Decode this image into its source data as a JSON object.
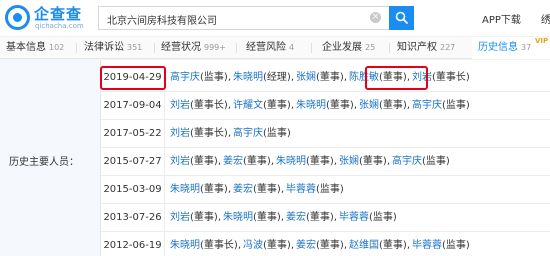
{
  "header": {
    "logo_title": "企查查",
    "logo_sub": "qichacha.com",
    "search_value": "北京六间房科技有限公司",
    "clear_glyph": "×",
    "app_download": "APP下载",
    "edge_text": "绣"
  },
  "tabs": [
    {
      "label": "基本信息",
      "count": "102"
    },
    {
      "label": "法律诉讼",
      "count": "351"
    },
    {
      "label": "经营状况",
      "count": "999+"
    },
    {
      "label": "经营风险",
      "count": "4"
    },
    {
      "label": "企业发展",
      "count": "25"
    },
    {
      "label": "知识产权",
      "count": "227"
    },
    {
      "label": "历史信息",
      "count": "37",
      "active": true
    }
  ],
  "vip_badge": "VIP",
  "section_label": "历史主要人员：",
  "rows": [
    {
      "date": "2019-04-29",
      "people": [
        {
          "name": "高宇庆",
          "role": "(监事)"
        },
        {
          "name": "朱晓明",
          "role": "(经理)"
        },
        {
          "name": "张娴",
          "role": "(董事)"
        },
        {
          "name": "陈胜敏",
          "role": "(董事)"
        },
        {
          "name": "刘岩",
          "role": "(董事长)"
        }
      ]
    },
    {
      "date": "2017-09-04",
      "people": [
        {
          "name": "刘岩",
          "role": "(董事长)"
        },
        {
          "name": "许耀文",
          "role": "(董事)"
        },
        {
          "name": "朱晓明",
          "role": "(董事)"
        },
        {
          "name": "张娴",
          "role": "(董事)"
        },
        {
          "name": "高宇庆",
          "role": "(监事)"
        }
      ]
    },
    {
      "date": "2017-05-22",
      "people": [
        {
          "name": "刘岩",
          "role": "(董事长)"
        },
        {
          "name": "高宇庆",
          "role": "(监事)"
        }
      ]
    },
    {
      "date": "2015-07-27",
      "people": [
        {
          "name": "刘岩",
          "role": "(董事)"
        },
        {
          "name": "姜宏",
          "role": "(董事)"
        },
        {
          "name": "朱晓明",
          "role": "(董事)"
        },
        {
          "name": "张娴",
          "role": "(董事)"
        },
        {
          "name": "高宇庆",
          "role": "(监事)"
        }
      ]
    },
    {
      "date": "2015-03-09",
      "people": [
        {
          "name": "朱晓明",
          "role": "(董事)"
        },
        {
          "name": "姜宏",
          "role": "(董事)"
        },
        {
          "name": "毕蓉蓉",
          "role": "(监事)"
        }
      ]
    },
    {
      "date": "2013-07-26",
      "people": [
        {
          "name": "刘岩",
          "role": "(董事)"
        },
        {
          "name": "朱晓明",
          "role": "(董事)"
        },
        {
          "name": "姜宏",
          "role": "(董事)"
        },
        {
          "name": "毕蓉蓉",
          "role": "(监事)"
        }
      ]
    },
    {
      "date": "2012-06-19",
      "people": [
        {
          "name": "朱晓明",
          "role": "(董事长)"
        },
        {
          "name": "冯波",
          "role": "(董事)"
        },
        {
          "name": "姜宏",
          "role": "(董事)"
        },
        {
          "name": "赵维国",
          "role": "(董事)"
        },
        {
          "name": "毕蓉蓉",
          "role": "(监事)"
        }
      ]
    }
  ],
  "colors": {
    "brand_blue": "#1b8cf2",
    "link_blue": "#1b73c8",
    "highlight_red": "#e4001b"
  }
}
